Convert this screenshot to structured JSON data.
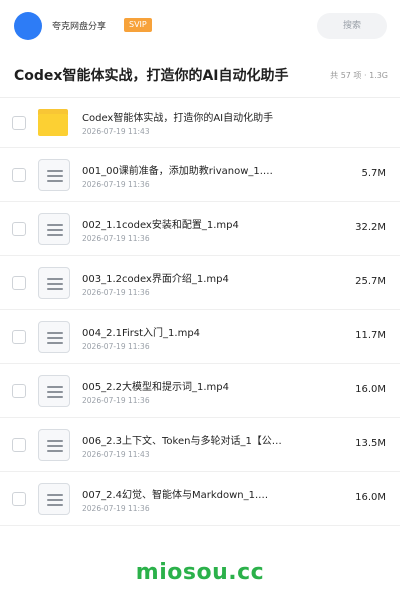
{
  "header": {
    "share_name": "夸克网盘分享",
    "badge": "SVIP",
    "search_label": "搜索"
  },
  "folder": {
    "title": "Codex智能体实战，打造你的AI自动化助手",
    "meta": "共 57 项 · 1.3G"
  },
  "items": [
    {
      "type": "folder",
      "name": "Codex智能体实战，打造你的AI自动化助手",
      "date": "2026-07-19 11:43",
      "size": ""
    },
    {
      "type": "file",
      "name": "001_00课前准备，添加助教rivanow_1.…",
      "date": "2026-07-19 11:36",
      "size": "5.7M"
    },
    {
      "type": "file",
      "name": "002_1.1codex安装和配置_1.mp4",
      "date": "2026-07-19 11:36",
      "size": "32.2M"
    },
    {
      "type": "file",
      "name": "003_1.2codex界面介绍_1.mp4",
      "date": "2026-07-19 11:36",
      "size": "25.7M"
    },
    {
      "type": "file",
      "name": "004_2.1First入门_1.mp4",
      "date": "2026-07-19 11:36",
      "size": "11.7M"
    },
    {
      "type": "file",
      "name": "005_2.2大模型和提示词_1.mp4",
      "date": "2026-07-19 11:36",
      "size": "16.0M"
    },
    {
      "type": "file",
      "name": "006_2.3上下文、Token与多轮对话_1【公…",
      "date": "2026-07-19 11:43",
      "size": "13.5M"
    },
    {
      "type": "file",
      "name": "007_2.4幻觉、智能体与Markdown_1.…",
      "date": "2026-07-19 11:36",
      "size": "16.0M"
    }
  ],
  "watermark": "miosou.cc",
  "colors": {
    "accent": "#2d7cf6",
    "badge": "#f7a23a",
    "folder": "#fcd033",
    "watermark": "#2bb14a"
  },
  "icons": {
    "folder": "folder-icon",
    "file": "file-icon"
  }
}
